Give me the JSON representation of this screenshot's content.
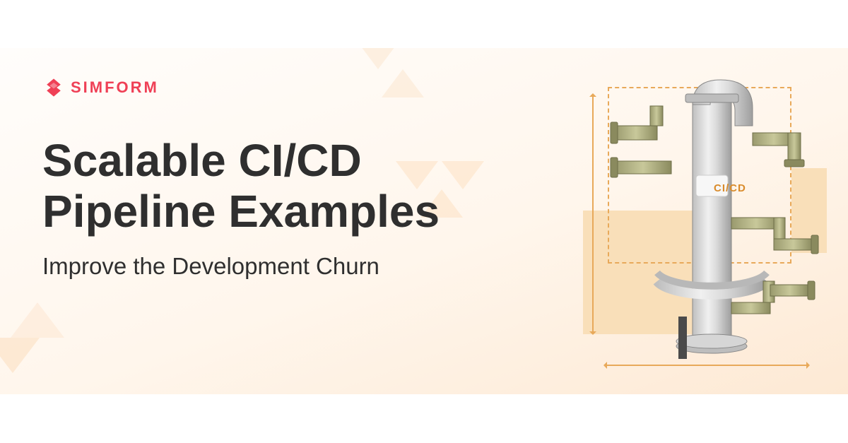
{
  "brand": {
    "name": "SIMFORM",
    "color": "#EF4056"
  },
  "headline": {
    "line1_prefix": "Scalable ",
    "line1_highlight": "CI/CD",
    "line2": "Pipeline Examples"
  },
  "subhead": "Improve the Development Churn",
  "illustration": {
    "label": "CI/CD"
  }
}
